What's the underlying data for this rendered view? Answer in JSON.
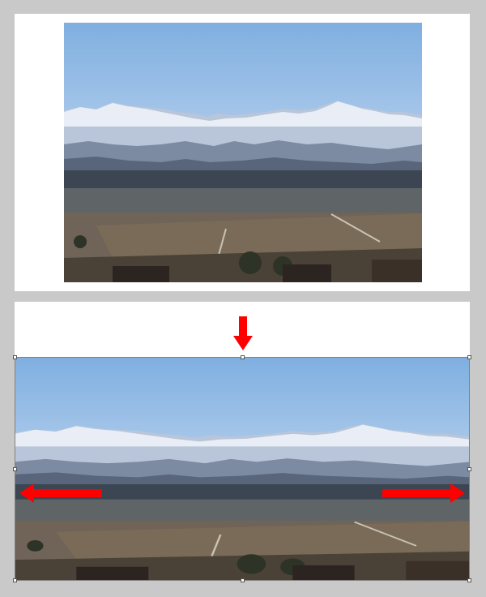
{
  "screenshot": {
    "background_color": "#c9c9c9",
    "canvas_color": "#ffffff",
    "arrow_color": "#ff0000",
    "top_panel": {
      "description_icon": "photo-before-stretch",
      "sky_color": "#8fb7e3"
    },
    "bottom_panel": {
      "description_icon": "photo-after-stretch",
      "sky_color": "#8fb7e3",
      "arrows": [
        "down-arrow",
        "left-arrow",
        "right-arrow"
      ]
    }
  }
}
